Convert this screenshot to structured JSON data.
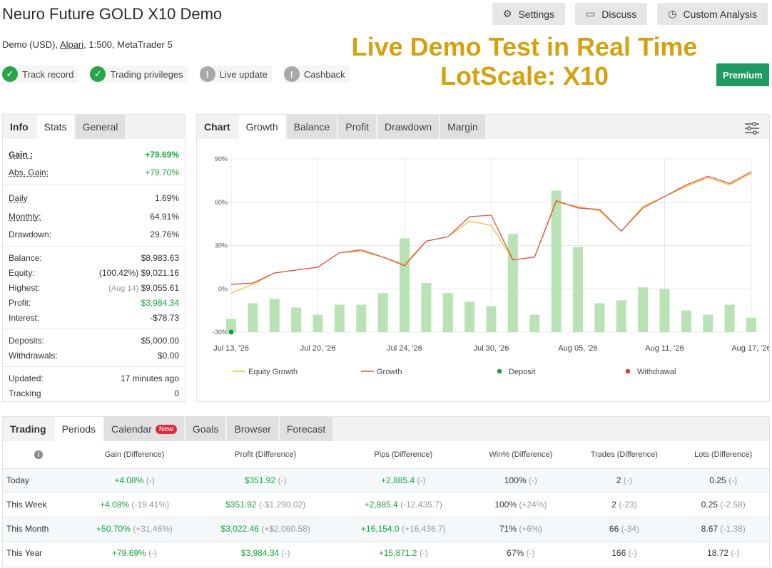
{
  "header": {
    "title": "Neuro Future GOLD X10 Demo",
    "account_type": "Demo (USD), ",
    "broker": "Alpari",
    "account_rest": ", 1:500, MetaTrader 5"
  },
  "badges": [
    {
      "label": "Track record",
      "status": "ok"
    },
    {
      "label": "Trading privileges",
      "status": "ok"
    },
    {
      "label": "Live update",
      "status": "warn"
    },
    {
      "label": "Cashback",
      "status": "warn"
    }
  ],
  "toolbar": {
    "settings": "Settings",
    "discuss": "Discuss",
    "custom_analysis": "Custom Analysis",
    "premium": "Premium"
  },
  "promo": {
    "line1": "Live Demo Test in Real Time",
    "line2": "LotScale: X10"
  },
  "info_tabs": [
    "Info",
    "Stats",
    "General"
  ],
  "stats": {
    "gain_label": "Gain :",
    "gain": "+79.69%",
    "abs_gain_label": "Abs. Gain:",
    "abs_gain": "+79.70%",
    "daily_label": "Daily",
    "daily": "1.69%",
    "monthly_label": "Monthly:",
    "monthly": "64.91%",
    "drawdown_label": "Drawdown:",
    "drawdown": "29.76%",
    "balance_label": "Balance:",
    "balance": "$8,983.63",
    "equity_label": "Equity:",
    "equity_pct": "(100.42%)",
    "equity": "$9,021.16",
    "highest_label": "Highest:",
    "highest_date": "(Aug 14)",
    "highest": "$9,055.61",
    "profit_label": "Profit:",
    "profit": "$3,984.34",
    "interest_label": "Interest:",
    "interest": "-$78.73",
    "deposits_label": "Deposits:",
    "deposits": "$5,000.00",
    "withdrawals_label": "Withdrawals:",
    "withdrawals": "$0.00",
    "updated_label": "Updated:",
    "updated": "17 minutes ago",
    "tracking_label": "Tracking",
    "tracking": "0"
  },
  "chart_tabs": [
    "Chart",
    "Growth",
    "Balance",
    "Profit",
    "Drawdown",
    "Margin"
  ],
  "chart_data": {
    "type": "line",
    "y_ticks": [
      "90%",
      "60%",
      "30%",
      "0%",
      "-30%"
    ],
    "ylim": [
      -30,
      90
    ],
    "x_labels": [
      "Jul 13, '26",
      "Jul 20, '26",
      "Jul 24, '26",
      "Jul 30, '26",
      "Aug 05, '26",
      "Aug 11, '26",
      "Aug 17, '26"
    ],
    "x_label_index": [
      0,
      4,
      8,
      12,
      16,
      20,
      24
    ],
    "n_points": 25,
    "grid": true,
    "bars": [
      -21,
      -10,
      -7,
      -13,
      -18,
      -11,
      -11,
      -3,
      35,
      4,
      -3,
      -9,
      -12,
      38,
      -18,
      68,
      29,
      -10,
      -8,
      1,
      0,
      -15,
      -18,
      -11,
      -20
    ],
    "series": [
      {
        "name": "Equity Growth",
        "color": "#f2c230",
        "values": [
          -3,
          3,
          11,
          13,
          15,
          25,
          26,
          22,
          17,
          33,
          36,
          47,
          44,
          20,
          22,
          60,
          57,
          54,
          40,
          57,
          64,
          71,
          77,
          72,
          80
        ]
      },
      {
        "name": "Growth",
        "color": "#d9534f",
        "values": [
          3,
          4,
          11,
          13,
          15,
          25,
          27,
          22,
          16,
          33,
          36,
          50,
          51,
          20,
          22,
          61,
          56,
          55,
          40,
          56,
          64,
          72,
          78,
          73,
          81
        ]
      }
    ],
    "bar_color": "#b9e2b5",
    "deposit": {
      "index": 0,
      "value": -30
    },
    "legend": [
      {
        "label": "Equity Growth",
        "kind": "line",
        "color": "#f2c230"
      },
      {
        "label": "Growth",
        "kind": "line",
        "color": "#d9534f"
      },
      {
        "label": "Deposit",
        "kind": "dot",
        "color": "#1e9a45"
      },
      {
        "label": "Withdrawal",
        "kind": "dot",
        "color": "#e03b3b"
      }
    ],
    "legend_position": "bottom"
  },
  "period_tabs": [
    "Trading",
    "Periods",
    "Calendar",
    "Goals",
    "Browser",
    "Forecast"
  ],
  "calendar_badge": "New",
  "periods": {
    "columns": [
      "Gain (Difference)",
      "Profit (Difference)",
      "Pips (Difference)",
      "Win% (Difference)",
      "Trades (Difference)",
      "Lots (Difference)"
    ],
    "rows": [
      {
        "name": "Today",
        "cells": [
          [
            "+4.08%",
            "(-)"
          ],
          [
            "$351.92",
            "(-)"
          ],
          [
            "+2,885.4",
            "(-)"
          ],
          [
            "100%",
            "(-)"
          ],
          [
            "2",
            "(-)"
          ],
          [
            "0.25",
            "(-)"
          ]
        ]
      },
      {
        "name": "This Week",
        "cells": [
          [
            "+4.08%",
            "(-19.41%)"
          ],
          [
            "$351.92",
            "(-$1,290.02)"
          ],
          [
            "+2,885.4",
            "(-12,435.7)"
          ],
          [
            "100%",
            "(+24%)"
          ],
          [
            "2",
            "(-23)"
          ],
          [
            "0.25",
            "(-2.58)"
          ]
        ]
      },
      {
        "name": "This Month",
        "cells": [
          [
            "+50.70%",
            "(+31.46%)"
          ],
          [
            "$3,022.46",
            "(+$2,060.58)"
          ],
          [
            "+16,154.0",
            "(+16,436.7)"
          ],
          [
            "71%",
            "(+6%)"
          ],
          [
            "66",
            "(-34)"
          ],
          [
            "8.67",
            "(-1.38)"
          ]
        ]
      },
      {
        "name": "This Year",
        "cells": [
          [
            "+79.69%",
            "(-)"
          ],
          [
            "$3,984.34",
            "(-)"
          ],
          [
            "+15,871.2",
            "(-)"
          ],
          [
            "67%",
            "(-)"
          ],
          [
            "166",
            "(-)"
          ],
          [
            "18.72",
            "(-)"
          ]
        ]
      }
    ]
  }
}
